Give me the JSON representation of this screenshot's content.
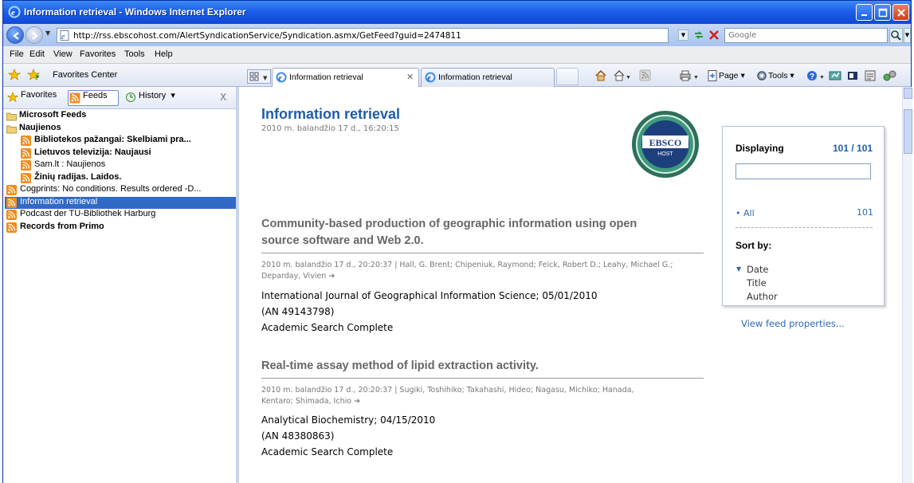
{
  "window": {
    "title": "Information retrieval - Windows Internet Explorer"
  },
  "address": {
    "url": "http://rss.ebscohost.com/AlertSyndicationService/Syndication.asmx/GetFeed?guid=2474811"
  },
  "search": {
    "placeholder": "Google"
  },
  "menu": {
    "items": [
      "File",
      "Edit",
      "View",
      "Favorites",
      "Tools",
      "Help"
    ]
  },
  "command": {
    "favorites_center": "Favorites Center",
    "tabs": [
      {
        "label": "Information retrieval"
      },
      {
        "label": "Information retrieval"
      }
    ],
    "page_label": "Page",
    "tools_label": "Tools"
  },
  "sidebar": {
    "tab_favorites": "Favorites",
    "tab_feeds": "Feeds",
    "tab_history": "History",
    "close": "X",
    "tree": [
      {
        "label": "Microsoft Feeds",
        "type": "folder",
        "bold": true
      },
      {
        "label": "Naujienos",
        "type": "folder",
        "bold": true
      },
      {
        "label": "Bibliotekos pažangai: Skelbiami pra...",
        "type": "feed",
        "bold": true
      },
      {
        "label": "Lietuvos televizija: Naujausi",
        "type": "feed",
        "bold": true
      },
      {
        "label": "Sam.lt : Naujienos",
        "type": "feed",
        "bold": false
      },
      {
        "label": "Žinių radijas. Laidos.",
        "type": "feed",
        "bold": true
      },
      {
        "label": "Cogprints: No conditions. Results ordered -D...",
        "type": "feed",
        "bold": false
      },
      {
        "label": "Information retrieval",
        "type": "feed",
        "bold": false,
        "selected": true
      },
      {
        "label": "Podcast der TU-Bibliothek Harburg",
        "type": "feed",
        "bold": false
      },
      {
        "label": "Records from Primo",
        "type": "feed",
        "bold": true
      }
    ]
  },
  "feed": {
    "title": "Information retrieval",
    "date": "2010 m. balandžio 17 d., 16:20:15",
    "logo_text_top": "EBSCO",
    "logo_text_bottom": "HOST",
    "items": [
      {
        "title_line1": "Community-based production of geographic information using open",
        "title_line2": "source software and Web 2.0.",
        "meta_line1": "2010 m. balandžio 17 d., 20:20:37 | Hall, G. Brent; Chipeniuk, Raymond; Feick, Robert D.; Leahy, Michael G.;",
        "meta_line2": "Deparday, Vivien",
        "body_line1": "International Journal of Geographical Information Science; 05/01/2010",
        "body_line2": "(AN 49143798)",
        "body_line3": "Academic Search Complete"
      },
      {
        "title_line1": "Real-time assay method of lipid extraction activity.",
        "meta_line1": "2010 m. balandžio 17 d., 20:20:37 | Sugiki, Toshihiko; Takahashi, Hideo; Nagasu, Michiko; Hanada,",
        "meta_line2": "Kentaro; Shimada, Ichio",
        "body_line1": "Analytical Biochemistry; 04/15/2010",
        "body_line2": "(AN 48380863)",
        "body_line3": "Academic Search Complete"
      }
    ]
  },
  "panel": {
    "displaying": "Displaying",
    "count": "101 / 101",
    "all_label": "All",
    "all_count": "101",
    "sort_by": "Sort by:",
    "sort_options": [
      "Date",
      "Title",
      "Author"
    ],
    "view_properties": "View feed properties..."
  },
  "colors": {
    "title_blue": "#1f5ca8",
    "link_blue": "#2e68b5",
    "selection": "#316ac5",
    "xp_blue": "#0a4fd8"
  }
}
